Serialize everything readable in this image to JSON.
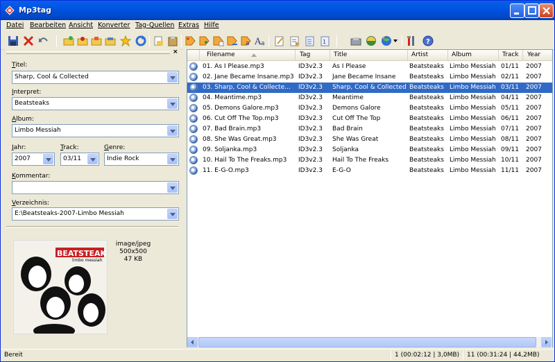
{
  "window": {
    "title": "Mp3tag"
  },
  "menu": [
    "Datei",
    "Bearbeiten",
    "Ansicht",
    "Konverter",
    "Tag-Quellen",
    "Extras",
    "Hilfe"
  ],
  "toolbar_icons": [
    "save-icon",
    "delete-icon",
    "undo-icon",
    "open-folder-icon",
    "add-folder-icon",
    "subfolder-icon",
    "playlist-icon",
    "favorite-star-icon",
    "refresh-icon",
    "copy-tag-icon",
    "paste-tag-icon",
    "tag-to-filename-icon",
    "filename-to-tag-icon",
    "text-to-tag-icon",
    "tag-to-tag-icon",
    "case-conversion-icon",
    "edit-icon",
    "export-icon",
    "import-icon",
    "playlist-export-icon",
    "freedb-icon",
    "amazon-icon",
    "web-sources-icon",
    "options-icon",
    "help-icon"
  ],
  "fields": {
    "titel": {
      "label": "Titel:",
      "ul": "T",
      "rest": "itel:",
      "value": "Sharp, Cool & Collected"
    },
    "interpret": {
      "label": "Interpret:",
      "ul": "I",
      "rest": "nterpret:",
      "value": "Beatsteaks"
    },
    "album": {
      "label": "Album:",
      "ul": "A",
      "rest": "lbum:",
      "value": "Limbo Messiah"
    },
    "jahr": {
      "label": "Jahr:",
      "ul": "J",
      "rest": "ahr:",
      "value": "2007"
    },
    "track": {
      "label": "Track:",
      "ul": "T",
      "rest": "rack:",
      "value": "03/11"
    },
    "genre": {
      "label": "Genre:",
      "ul": "G",
      "rest": "enre:",
      "value": "Indie Rock"
    },
    "kommentar": {
      "label": "Kommentar:",
      "ul": "K",
      "rest": "ommentar:",
      "value": ""
    },
    "verzeichnis": {
      "label": "Verzeichnis:",
      "ul": "V",
      "rest": "erzeichnis:",
      "value": "E:\\Beatsteaks-2007-Limbo Messiah"
    }
  },
  "cover": {
    "band": "BEATSTEAKS",
    "album": "limbo messiah",
    "mime": "image/jpeg",
    "dims": "500x500",
    "size": "47 KB"
  },
  "columns": [
    "Filename",
    "Tag",
    "Title",
    "Artist",
    "Album",
    "Track",
    "Year"
  ],
  "rows": [
    {
      "filename": "01. As I Please.mp3",
      "tag": "ID3v2.3",
      "title": "As I Please",
      "artist": "Beatsteaks",
      "album": "Limbo Messiah",
      "track": "01/11",
      "year": "2007"
    },
    {
      "filename": "02. Jane Became Insane.mp3",
      "tag": "ID3v2.3",
      "title": "Jane Became Insane",
      "artist": "Beatsteaks",
      "album": "Limbo Messiah",
      "track": "02/11",
      "year": "2007"
    },
    {
      "filename": "03. Sharp, Cool & Collecte...",
      "tag": "ID3v2.3",
      "title": "Sharp, Cool & Collected",
      "artist": "Beatsteaks",
      "album": "Limbo Messiah",
      "track": "03/11",
      "year": "2007"
    },
    {
      "filename": "04. Meantime.mp3",
      "tag": "ID3v2.3",
      "title": "Meantime",
      "artist": "Beatsteaks",
      "album": "Limbo Messiah",
      "track": "04/11",
      "year": "2007"
    },
    {
      "filename": "05. Demons Galore.mp3",
      "tag": "ID3v2.3",
      "title": "Demons Galore",
      "artist": "Beatsteaks",
      "album": "Limbo Messiah",
      "track": "05/11",
      "year": "2007"
    },
    {
      "filename": "06. Cut Off The Top.mp3",
      "tag": "ID3v2.3",
      "title": "Cut Off The Top",
      "artist": "Beatsteaks",
      "album": "Limbo Messiah",
      "track": "06/11",
      "year": "2007"
    },
    {
      "filename": "07. Bad Brain.mp3",
      "tag": "ID3v2.3",
      "title": "Bad Brain",
      "artist": "Beatsteaks",
      "album": "Limbo Messiah",
      "track": "07/11",
      "year": "2007"
    },
    {
      "filename": "08. She Was Great.mp3",
      "tag": "ID3v2.3",
      "title": "She Was Great",
      "artist": "Beatsteaks",
      "album": "Limbo Messiah",
      "track": "08/11",
      "year": "2007"
    },
    {
      "filename": "09. Soljanka.mp3",
      "tag": "ID3v2.3",
      "title": "Soljanka",
      "artist": "Beatsteaks",
      "album": "Limbo Messiah",
      "track": "09/11",
      "year": "2007"
    },
    {
      "filename": "10. Hail To The Freaks.mp3",
      "tag": "ID3v2.3",
      "title": "Hail To The Freaks",
      "artist": "Beatsteaks",
      "album": "Limbo Messiah",
      "track": "10/11",
      "year": "2007"
    },
    {
      "filename": "11. E-G-O.mp3",
      "tag": "ID3v2.3",
      "title": "E-G-O",
      "artist": "Beatsteaks",
      "album": "Limbo Messiah",
      "track": "11/11",
      "year": "2007"
    }
  ],
  "selected_row": 2,
  "status": {
    "left": "Bereit",
    "selection": "1 (00:02:12 | 3,0MB)",
    "total": "11 (00:31:24 | 44,2MB)"
  },
  "colors": {
    "titlebar": "#0054e3",
    "selection": "#316ac5",
    "face": "#ece9d8"
  }
}
